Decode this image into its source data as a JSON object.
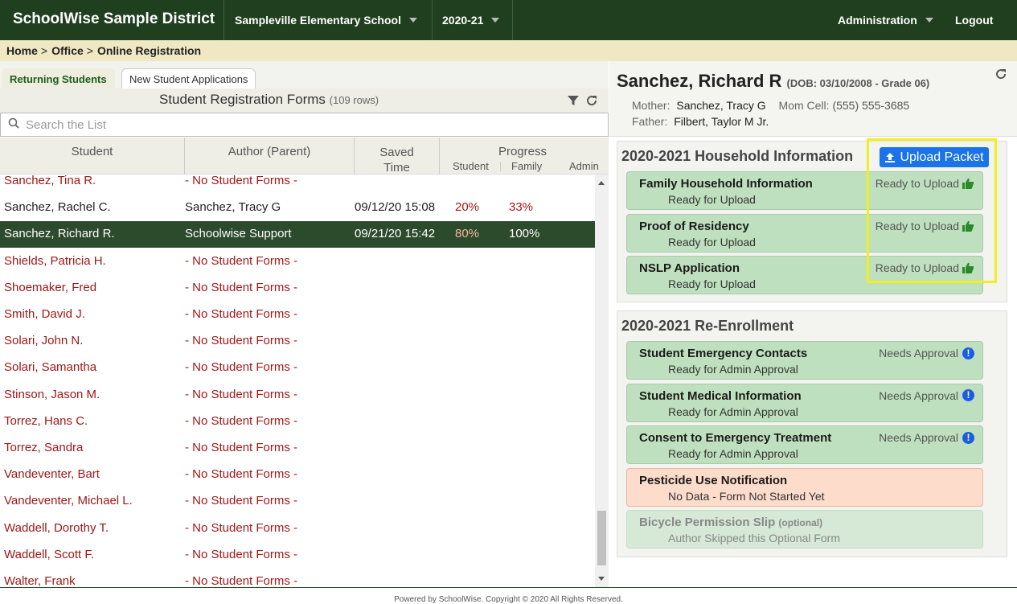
{
  "topbar": {
    "brand": "SchoolWise Sample District",
    "school": "Sampleville Elementary School",
    "year": "2020-21",
    "admin": "Administration",
    "logout": "Logout"
  },
  "breadcrumb": [
    "Home",
    "Office",
    "Online Registration"
  ],
  "tabs": [
    "Returning Students",
    "New Student Applications"
  ],
  "list": {
    "title": "Student Registration Forms",
    "count": "(109 rows)",
    "search_placeholder": "Search the List",
    "columns": {
      "student": "Student",
      "author": "Author (Parent)",
      "saved_line1": "Saved",
      "saved_line2": "Time",
      "progress": "Progress",
      "progress_student": "Student",
      "progress_family": "Family",
      "progress_admin": "Admin"
    },
    "rows": [
      {
        "student": "Sanchez, Tina R.",
        "author": "- No Student Forms -",
        "saved": "",
        "p_student": "",
        "p_family": "",
        "style": "red"
      },
      {
        "student": "Sanchez, Rachel C.",
        "author": "Sanchez, Tracy G",
        "saved": "09/12/20 15:08",
        "p_student": "20%",
        "p_family": "33%",
        "style": "normal"
      },
      {
        "student": "Sanchez, Richard R.",
        "author": "Schoolwise Support",
        "saved": "09/21/20 15:42",
        "p_student": "80%",
        "p_family": "100%",
        "style": "sel"
      },
      {
        "student": "Shields, Patricia H.",
        "author": "- No Student Forms -",
        "saved": "",
        "p_student": "",
        "p_family": "",
        "style": "red"
      },
      {
        "student": "Shoemaker, Fred",
        "author": "- No Student Forms -",
        "saved": "",
        "p_student": "",
        "p_family": "",
        "style": "red"
      },
      {
        "student": "Smith, David J.",
        "author": "- No Student Forms -",
        "saved": "",
        "p_student": "",
        "p_family": "",
        "style": "red"
      },
      {
        "student": "Solari, John N.",
        "author": "- No Student Forms -",
        "saved": "",
        "p_student": "",
        "p_family": "",
        "style": "red"
      },
      {
        "student": "Solari, Samantha",
        "author": "- No Student Forms -",
        "saved": "",
        "p_student": "",
        "p_family": "",
        "style": "red"
      },
      {
        "student": "Stinson, Jason M.",
        "author": "- No Student Forms -",
        "saved": "",
        "p_student": "",
        "p_family": "",
        "style": "red"
      },
      {
        "student": "Torrez, Hans C.",
        "author": "- No Student Forms -",
        "saved": "",
        "p_student": "",
        "p_family": "",
        "style": "red"
      },
      {
        "student": "Torrez, Sandra",
        "author": "- No Student Forms -",
        "saved": "",
        "p_student": "",
        "p_family": "",
        "style": "red"
      },
      {
        "student": "Vandeventer, Bart",
        "author": "- No Student Forms -",
        "saved": "",
        "p_student": "",
        "p_family": "",
        "style": "red"
      },
      {
        "student": "Vandeventer, Michael L.",
        "author": "- No Student Forms -",
        "saved": "",
        "p_student": "",
        "p_family": "",
        "style": "red"
      },
      {
        "student": "Waddell, Dorothy T.",
        "author": "- No Student Forms -",
        "saved": "",
        "p_student": "",
        "p_family": "",
        "style": "red"
      },
      {
        "student": "Waddell, Scott F.",
        "author": "- No Student Forms -",
        "saved": "",
        "p_student": "",
        "p_family": "",
        "style": "red"
      },
      {
        "student": "Walter, Frank",
        "author": "- No Student Forms -",
        "saved": "",
        "p_student": "",
        "p_family": "",
        "style": "red"
      }
    ]
  },
  "detail": {
    "name": "Sanchez, Richard R",
    "dob": "(DOB: 03/10/2008 - Grade 06)",
    "mother_label": "Mother:",
    "mother": "Sanchez, Tracy G",
    "mom_cell_label": "Mom Cell:",
    "mom_cell": "(555) 555-3685",
    "father_label": "Father:",
    "father": "Filbert, Taylor M Jr.",
    "upload_label": "Upload Packet",
    "groups": [
      {
        "title": "2020-2021 Household Information",
        "forms": [
          {
            "name": "Family Household Information",
            "optional": "",
            "sub": "Ready for Upload",
            "status": "Ready to Upload",
            "icon": "thumbs-up-icon",
            "style": "green"
          },
          {
            "name": "Proof of Residency",
            "optional": "",
            "sub": "Ready for Upload",
            "status": "Ready to Upload",
            "icon": "thumbs-up-icon",
            "style": "green"
          },
          {
            "name": "NSLP Application",
            "optional": "",
            "sub": "Ready for Upload",
            "status": "Ready to Upload",
            "icon": "thumbs-up-icon",
            "style": "green"
          }
        ]
      },
      {
        "title": "2020-2021 Re-Enrollment",
        "forms": [
          {
            "name": "Student Emergency Contacts",
            "optional": "",
            "sub": "Ready for Admin Approval",
            "status": "Needs Approval",
            "icon": "exclamation-icon",
            "style": "green"
          },
          {
            "name": "Student Medical Information",
            "optional": "",
            "sub": "Ready for Admin Approval",
            "status": "Needs Approval",
            "icon": "exclamation-icon",
            "style": "green"
          },
          {
            "name": "Consent to Emergency Treatment",
            "optional": "",
            "sub": "Ready for Admin Approval",
            "status": "Needs Approval",
            "icon": "exclamation-icon",
            "style": "green"
          },
          {
            "name": "Pesticide Use Notification",
            "optional": "",
            "sub": "No Data - Form Not Started Yet",
            "status": "",
            "icon": "",
            "style": "red"
          },
          {
            "name": "Bicycle Permission Slip",
            "optional": "(optional)",
            "sub": "Author Skipped this Optional Form",
            "status": "",
            "icon": "",
            "style": "grey"
          }
        ]
      }
    ]
  },
  "footer": "Powered by SchoolWise. Copyright © 2020 All Rights Reserved.",
  "colors": {
    "topbar": "#1f3f1f",
    "selected_row": "#2c4a2c",
    "link_red": "#a01818",
    "upload_blue": "#1a73e8",
    "highlight": "#f0f020"
  }
}
